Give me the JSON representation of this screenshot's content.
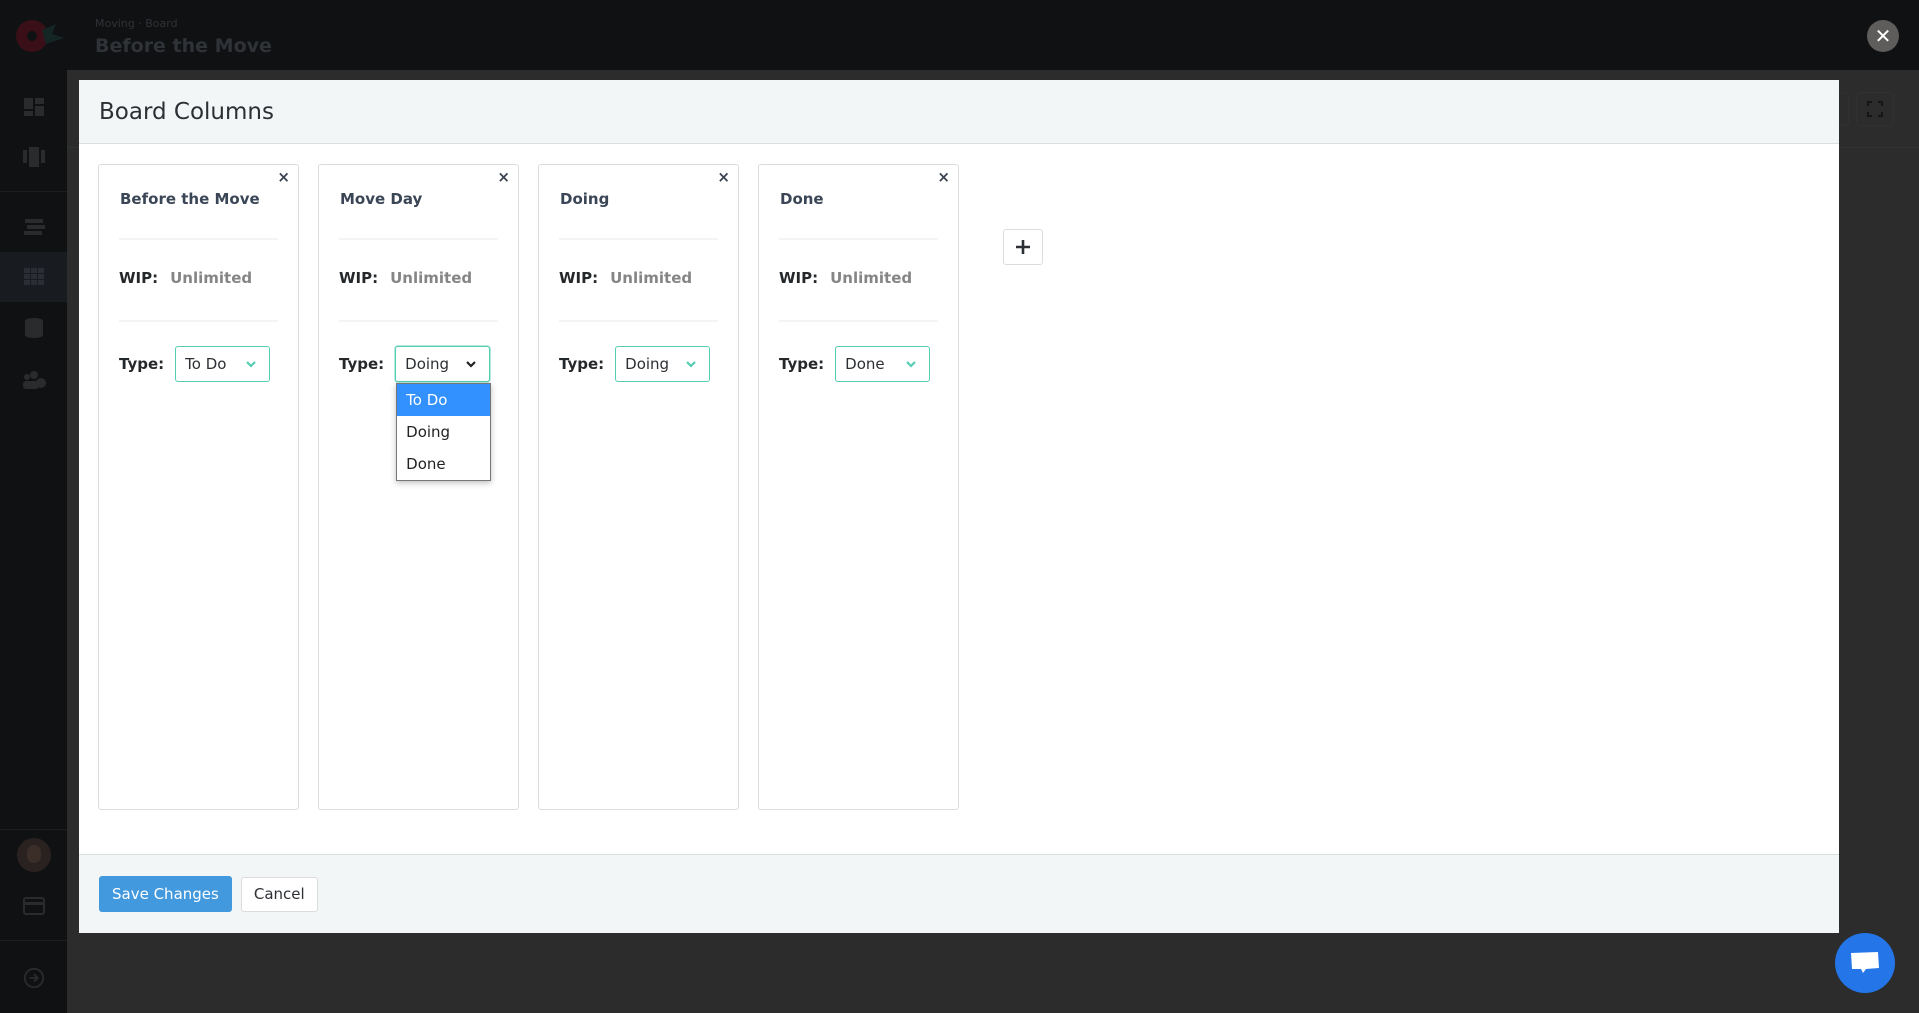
{
  "app": {
    "breadcrumb": "Moving · Board",
    "board_title": "Before the Move"
  },
  "sidebar": {
    "items": [
      {
        "icon": "dashboard-icon"
      },
      {
        "icon": "boards-icon"
      },
      {
        "icon": "list-icon"
      },
      {
        "icon": "grid-icon",
        "active": true
      },
      {
        "icon": "database-icon"
      },
      {
        "icon": "team-settings-icon"
      }
    ],
    "bottom": [
      {
        "icon": "avatar"
      },
      {
        "icon": "billing-card-icon"
      },
      {
        "icon": "logout-icon"
      }
    ]
  },
  "modal": {
    "title": "Board Columns",
    "columns": [
      {
        "name": "Before the Move",
        "wip_label": "WIP:",
        "wip_value": "Unlimited",
        "type_label": "Type:",
        "type": "To Do"
      },
      {
        "name": "Move Day",
        "wip_label": "WIP:",
        "wip_value": "Unlimited",
        "type_label": "Type:",
        "type": "Doing"
      },
      {
        "name": "Doing",
        "wip_label": "WIP:",
        "wip_value": "Unlimited",
        "type_label": "Type:",
        "type": "Doing"
      },
      {
        "name": "Done",
        "wip_label": "WIP:",
        "wip_value": "Unlimited",
        "type_label": "Type:",
        "type": "Done"
      }
    ],
    "remove_symbol": "×",
    "type_options": [
      "To Do",
      "Doing",
      "Done"
    ],
    "open_dropdown": {
      "column_index": 1,
      "highlighted": "To Do"
    },
    "add_column_symbol": "+",
    "save_label": "Save Changes",
    "cancel_label": "Cancel"
  },
  "overlay": {
    "close_symbol": "✕"
  },
  "colors": {
    "accent_teal": "#54cdb2",
    "primary_blue": "#4299de",
    "dropdown_highlight": "#3390ff",
    "chat_blue": "#2475e8"
  }
}
